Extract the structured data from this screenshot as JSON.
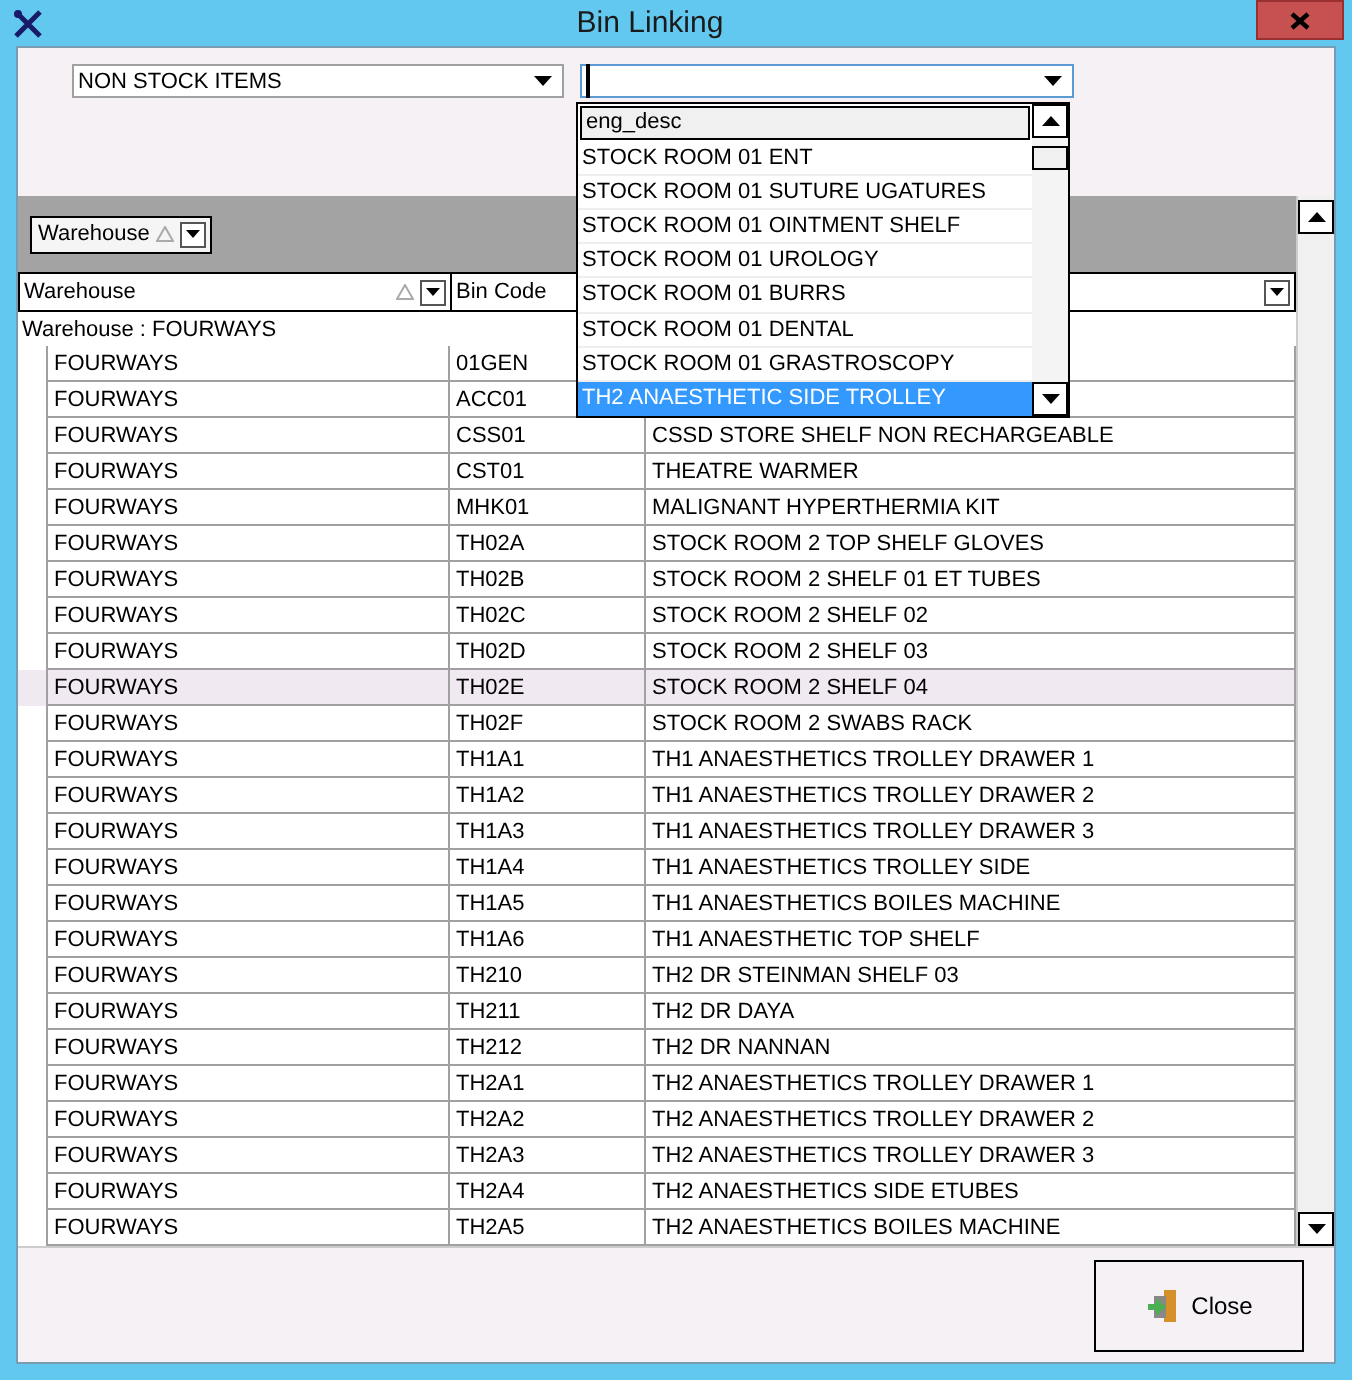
{
  "window": {
    "title": "Bin Linking"
  },
  "filters": {
    "category": {
      "value": "NON STOCK ITEMS"
    },
    "bin": {
      "open": true,
      "list_header": "eng_desc",
      "options": [
        {
          "label": "STOCK ROOM 01 ENT",
          "selected": false
        },
        {
          "label": "STOCK ROOM 01 SUTURE UGATURES",
          "selected": false
        },
        {
          "label": "STOCK ROOM 01 OINTMENT SHELF",
          "selected": false
        },
        {
          "label": "STOCK ROOM 01 UROLOGY",
          "selected": false
        },
        {
          "label": "STOCK ROOM 01 BURRS",
          "selected": false
        },
        {
          "label": "STOCK ROOM 01 DENTAL",
          "selected": false
        },
        {
          "label": "STOCK ROOM 01 GRASTROSCOPY",
          "selected": false
        },
        {
          "label": "TH2 ANAESTHETIC SIDE TROLLEY",
          "selected": true
        }
      ]
    }
  },
  "group_panel": {
    "chips": [
      {
        "label": "Warehouse"
      }
    ]
  },
  "table": {
    "columns": [
      {
        "label": "Warehouse"
      },
      {
        "label": "Bin Code"
      }
    ],
    "group": {
      "label": "Warehouse : FOURWAYS"
    },
    "rows": [
      {
        "warehouse": "FOURWAYS",
        "bin_code": "01GEN",
        "selected": false
      },
      {
        "warehouse": "FOURWAYS",
        "bin_code": "ACC01",
        "selected": false
      },
      {
        "warehouse": "FOURWAYS",
        "bin_code": "CSS01",
        "description": "CSSD STORE SHELF NON RECHARGEABLE",
        "selected": false
      },
      {
        "warehouse": "FOURWAYS",
        "bin_code": "CST01",
        "description": "THEATRE WARMER",
        "selected": false
      },
      {
        "warehouse": "FOURWAYS",
        "bin_code": "MHK01",
        "description": "MALIGNANT HYPERTHERMIA KIT",
        "selected": false
      },
      {
        "warehouse": "FOURWAYS",
        "bin_code": "TH02A",
        "description": "STOCK ROOM 2 TOP SHELF GLOVES",
        "selected": false
      },
      {
        "warehouse": "FOURWAYS",
        "bin_code": "TH02B",
        "description": "STOCK ROOM 2 SHELF 01 ET TUBES",
        "selected": false
      },
      {
        "warehouse": "FOURWAYS",
        "bin_code": "TH02C",
        "description": "STOCK ROOM 2 SHELF 02",
        "selected": false
      },
      {
        "warehouse": "FOURWAYS",
        "bin_code": "TH02D",
        "description": "STOCK ROOM 2 SHELF 03",
        "selected": false
      },
      {
        "warehouse": "FOURWAYS",
        "bin_code": "TH02E",
        "description": "STOCK ROOM 2 SHELF 04",
        "selected": true
      },
      {
        "warehouse": "FOURWAYS",
        "bin_code": "TH02F",
        "description": "STOCK ROOM 2 SWABS RACK",
        "selected": false
      },
      {
        "warehouse": "FOURWAYS",
        "bin_code": "TH1A1",
        "description": "TH1 ANAESTHETICS TROLLEY DRAWER 1",
        "selected": false
      },
      {
        "warehouse": "FOURWAYS",
        "bin_code": "TH1A2",
        "description": "TH1 ANAESTHETICS TROLLEY DRAWER 2",
        "selected": false
      },
      {
        "warehouse": "FOURWAYS",
        "bin_code": "TH1A3",
        "description": "TH1 ANAESTHETICS TROLLEY DRAWER 3",
        "selected": false
      },
      {
        "warehouse": "FOURWAYS",
        "bin_code": "TH1A4",
        "description": "TH1 ANAESTHETICS TROLLEY SIDE",
        "selected": false
      },
      {
        "warehouse": "FOURWAYS",
        "bin_code": "TH1A5",
        "description": "TH1 ANAESTHETICS BOILES MACHINE",
        "selected": false
      },
      {
        "warehouse": "FOURWAYS",
        "bin_code": "TH1A6",
        "description": "TH1 ANAESTHETIC TOP SHELF",
        "selected": false
      },
      {
        "warehouse": "FOURWAYS",
        "bin_code": "TH210",
        "description": "TH2 DR STEINMAN SHELF 03",
        "selected": false
      },
      {
        "warehouse": "FOURWAYS",
        "bin_code": "TH211",
        "description": "TH2 DR DAYA",
        "selected": false
      },
      {
        "warehouse": "FOURWAYS",
        "bin_code": "TH212",
        "description": "TH2 DR NANNAN",
        "selected": false
      },
      {
        "warehouse": "FOURWAYS",
        "bin_code": "TH2A1",
        "description": "TH2 ANAESTHETICS TROLLEY DRAWER 1",
        "selected": false
      },
      {
        "warehouse": "FOURWAYS",
        "bin_code": "TH2A2",
        "description": "TH2 ANAESTHETICS TROLLEY DRAWER 2",
        "selected": false
      },
      {
        "warehouse": "FOURWAYS",
        "bin_code": "TH2A3",
        "description": "TH2 ANAESTHETICS TROLLEY DRAWER 3",
        "selected": false
      },
      {
        "warehouse": "FOURWAYS",
        "bin_code": "TH2A4",
        "description": "TH2 ANAESTHETICS SIDE ETUBES",
        "selected": false
      },
      {
        "warehouse": "FOURWAYS",
        "bin_code": "TH2A5",
        "description": "TH2 ANAESTHETICS BOILES MACHINE",
        "selected": false
      }
    ]
  },
  "buttons": [
    {
      "label": "Close"
    }
  ]
}
